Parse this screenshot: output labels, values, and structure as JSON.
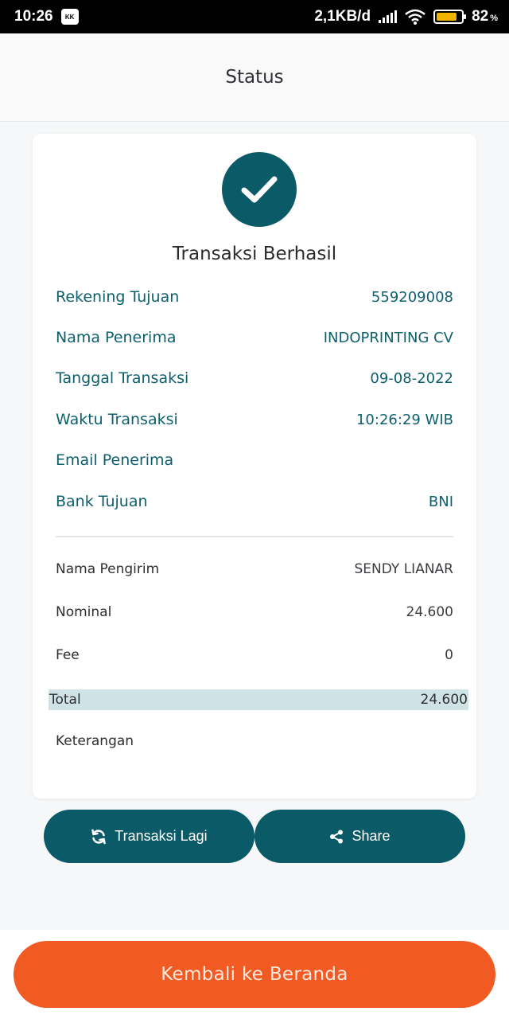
{
  "status_bar": {
    "time": "10:26",
    "app_icon": "kk-icon",
    "network_speed": "2,1KB/d",
    "battery_percent": "82",
    "battery_level": 0.82,
    "pct_sign": "%"
  },
  "header": {
    "title": "Status"
  },
  "card": {
    "status_icon": "check-icon",
    "title": "Transaksi Berhasil",
    "details": [
      {
        "label": "Rekening Tujuan",
        "value": "559209008"
      },
      {
        "label": "Nama Penerima",
        "value": "INDOPRINTING CV"
      },
      {
        "label": "Tanggal Transaksi",
        "value": "09-08-2022"
      },
      {
        "label": "Waktu Transaksi",
        "value": "10:26:29 WIB"
      },
      {
        "label": "Email Penerima",
        "value": ""
      },
      {
        "label": "Bank Tujuan",
        "value": "BNI"
      }
    ],
    "summary": [
      {
        "label": "Nama Pengirim",
        "value": "SENDY LIANAR"
      },
      {
        "label": "Nominal",
        "value": "24.600"
      },
      {
        "label": "Fee",
        "value": "0"
      }
    ],
    "total": {
      "label": "Total",
      "value": "24.600"
    },
    "note": {
      "label": "Keterangan",
      "value": ""
    }
  },
  "actions": {
    "again_label": "Transaksi Lagi",
    "again_icon": "refresh-icon",
    "share_label": "Share",
    "share_icon": "share-icon"
  },
  "footer": {
    "home_label": "Kembali ke Beranda"
  },
  "colors": {
    "primary": "#0b5a68",
    "accent": "#f15a22",
    "total_highlight": "#cfe3e6"
  }
}
